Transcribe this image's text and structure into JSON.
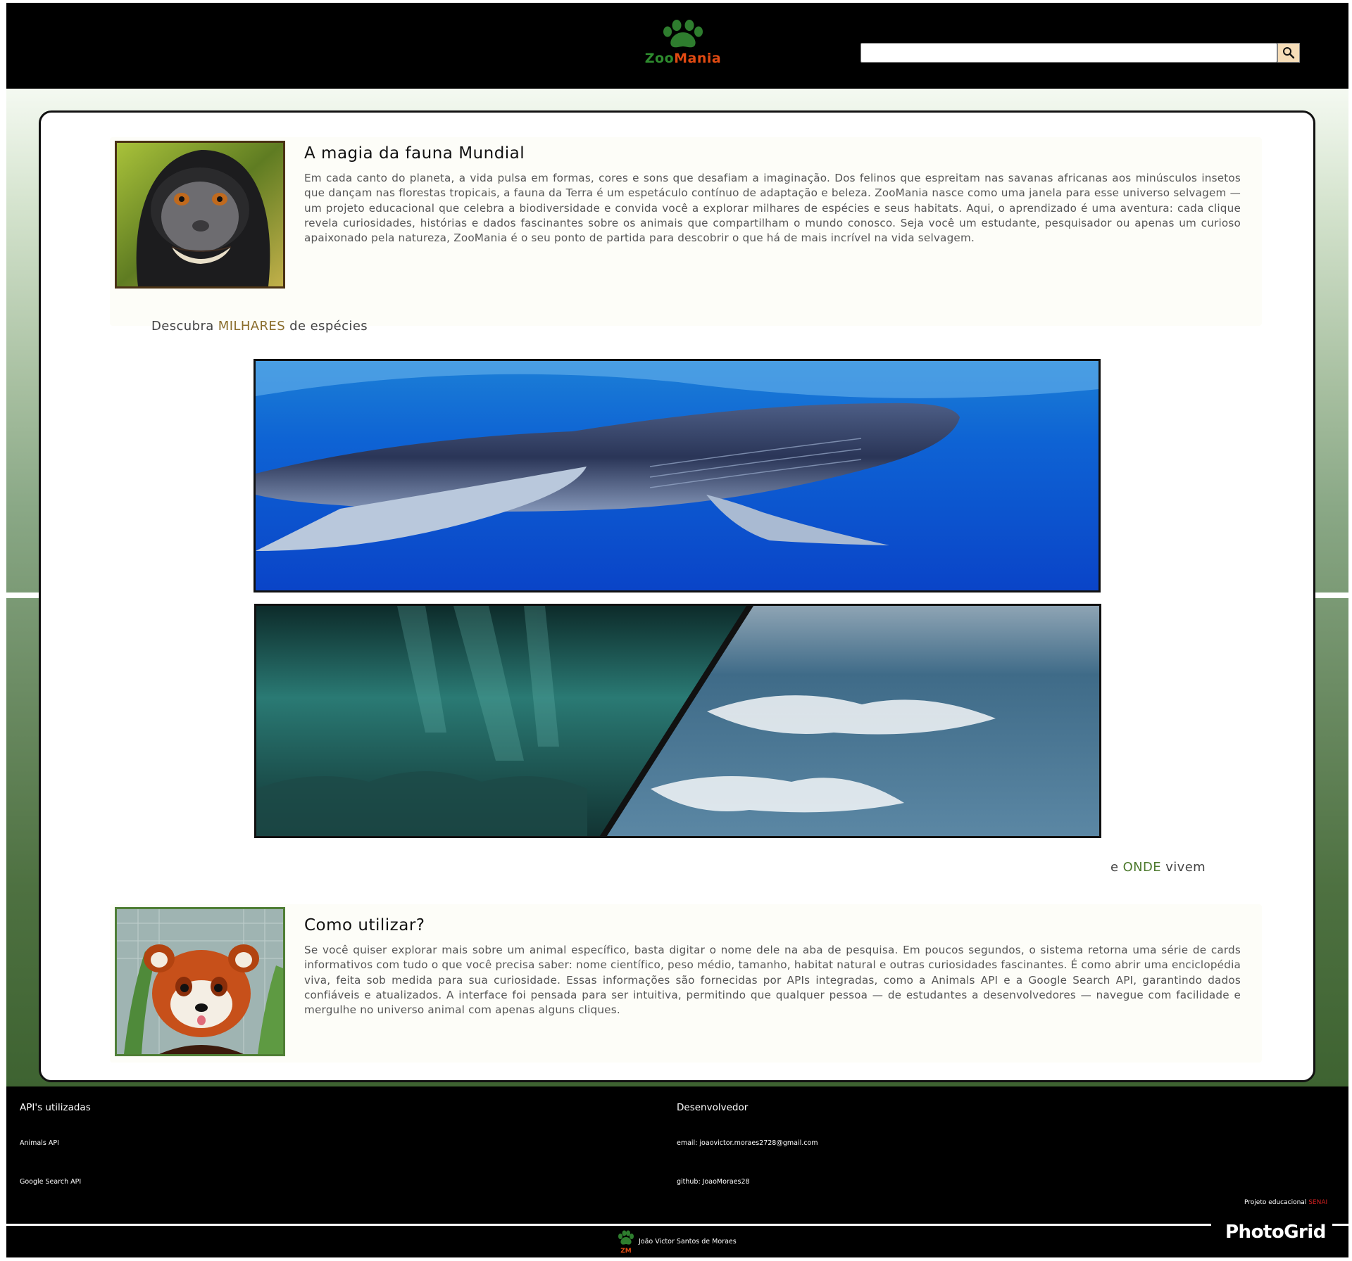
{
  "header": {
    "logo": {
      "zoo": "Zoo",
      "mania": "Mania"
    },
    "search": {
      "value": "",
      "placeholder": ""
    },
    "search_icon": "magnifier-icon"
  },
  "intro": {
    "title": "A magia da fauna Mundial",
    "body": "Em cada canto do planeta, a vida pulsa em formas, cores e sons que desafiam a imaginação. Dos felinos que espreitam nas savanas africanas aos minúsculos insetos que dançam nas florestas tropicais, a fauna da Terra é um espetáculo contínuo de adaptação e beleza. ZooMania nasce como uma janela para esse universo selvagem — um projeto educacional que celebra a biodiversidade e convida você a explorar milhares de espécies e seus habitats. Aqui, o aprendizado é uma aventura: cada clique revela curiosidades, histórias e dados fascinantes sobre os animais que compartilham o mundo conosco. Seja você um estudante, pesquisador ou apenas um curioso apaixonado pela natureza, ZooMania é o seu ponto de partida para descobrir o que há de mais incrível na vida selvagem."
  },
  "tagline_species": {
    "before": "Descubra ",
    "highlight": "MILHARES",
    "after": " de espécies"
  },
  "tagline_habitat": {
    "before": "e ",
    "highlight": "ONDE",
    "after": " vivem"
  },
  "howto": {
    "title": "Como utilizar?",
    "body": "Se você quiser explorar mais sobre um animal específico, basta digitar o nome dele na aba de pesquisa. Em poucos segundos, o sistema retorna uma série de cards informativos com tudo o que você precisa saber: nome científico, peso médio, tamanho, habitat natural e outras curiosidades fascinantes. É como abrir uma enciclopédia viva, feita sob medida para sua curiosidade. Essas informações são fornecidas por APIs integradas, como a Animals API e a Google Search API, garantindo dados confiáveis e atualizados. A interface foi pensada para ser intuitiva, permitindo que qualquer pessoa — de estudantes a desenvolvedores — navegue com facilidade e mergulhe no universo animal com apenas alguns cliques."
  },
  "footer": {
    "apis_heading": "API's utilizadas",
    "api_1": "Animals API",
    "api_2": "Google Search API",
    "dev_heading": "Desenvolvedor",
    "email": "email: joaovictor.moraes2728@gmail.com",
    "github": "github: JoaoMoraes28",
    "project_note": "Projeto educacional",
    "project_org": "SENAI",
    "credit": "João Victor Santos de Moraes",
    "credit_logo": "ZM"
  },
  "watermark": "PhotoGrid",
  "colors": {
    "header_bg": "#000000",
    "logo_green": "#2e8b2e",
    "logo_orange": "#e14a12",
    "search_button": "#f6ddb8",
    "accent_brown": "#8a6d2c",
    "accent_green": "#4e7a2e"
  }
}
